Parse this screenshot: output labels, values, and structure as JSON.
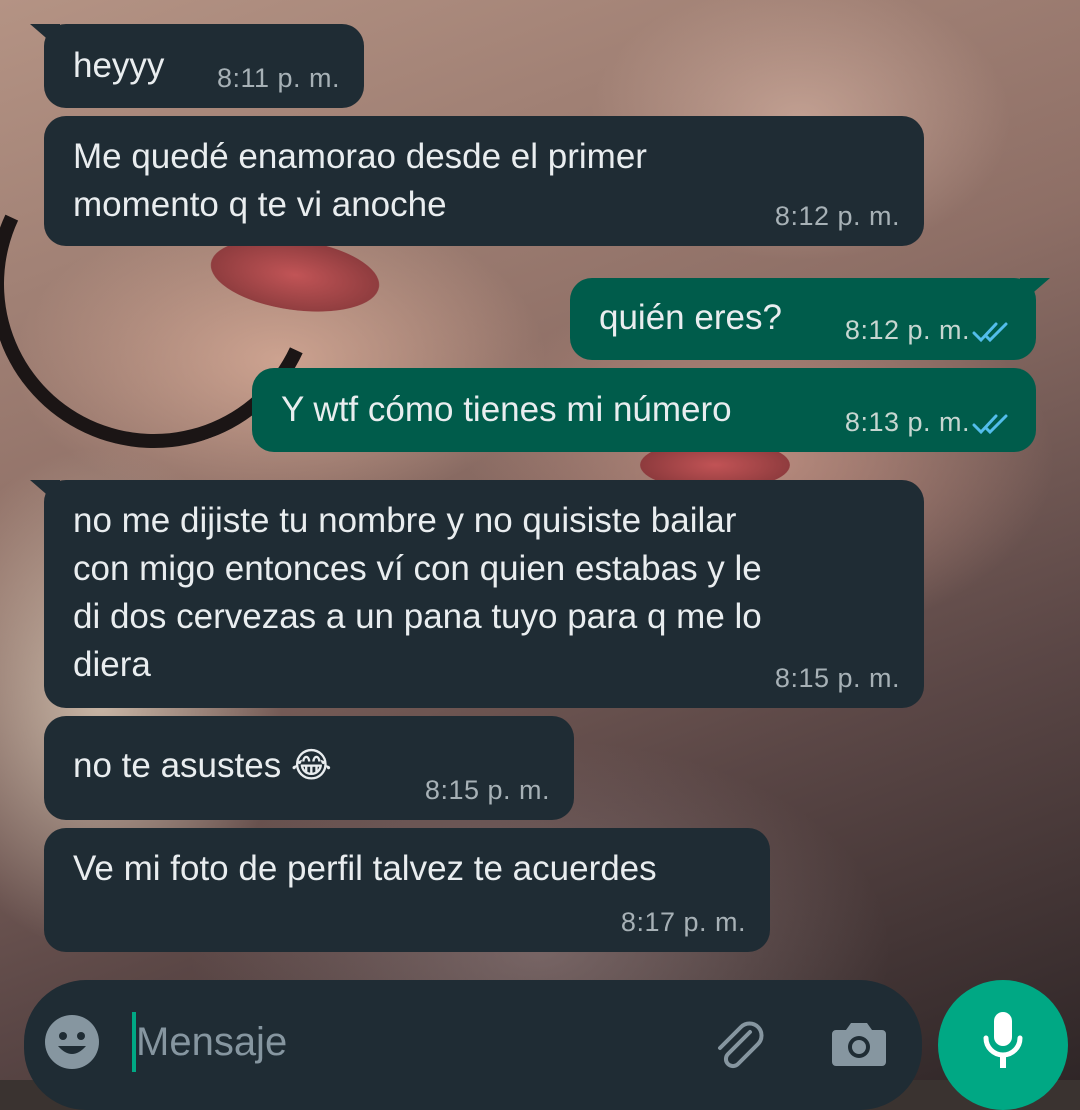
{
  "messages": [
    {
      "direction": "in",
      "text": "heyyy",
      "time": "8:11 p. m."
    },
    {
      "direction": "in",
      "text": "Me quedé enamorao desde el primer\nmomento q te vi anoche",
      "time": "8:12 p. m."
    },
    {
      "direction": "out",
      "text": "quién eres?",
      "time": "8:12 p. m.",
      "status": "read"
    },
    {
      "direction": "out",
      "text": "Y wtf cómo tienes mi número",
      "time": "8:13 p. m.",
      "status": "read"
    },
    {
      "direction": "in",
      "text": "no me dijiste tu nombre y no quisiste bailar\ncon migo entonces ví con quien estabas y le\ndi dos cervezas a un pana tuyo para q me lo\ndiera",
      "time": "8:15 p. m."
    },
    {
      "direction": "in",
      "text": "no te asustes 😂",
      "time": "8:15 p. m."
    },
    {
      "direction": "in",
      "text": "Ve mi foto de perfil talvez te acuerdes",
      "time": "8:17 p. m."
    }
  ],
  "composer": {
    "placeholder": "Mensaje",
    "emoji_icon": "emoji-icon",
    "attach_icon": "paperclip-icon",
    "camera_icon": "camera-icon",
    "mic_icon": "microphone-icon"
  },
  "colors": {
    "incoming_bubble": "#1f2c34",
    "outgoing_bubble": "#005c4b",
    "accent": "#00a884",
    "read_ticks": "#53bdeb"
  }
}
